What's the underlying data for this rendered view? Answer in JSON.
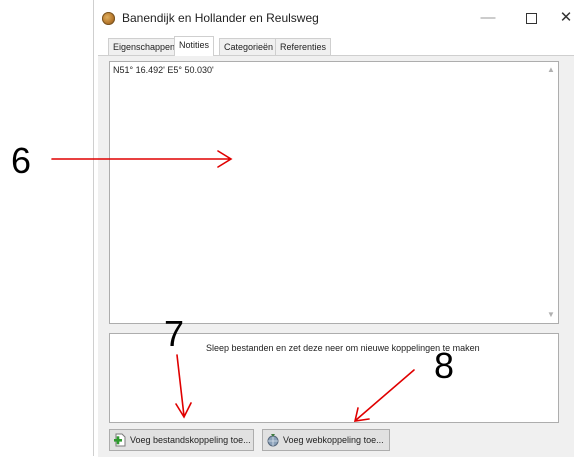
{
  "window": {
    "title": "Banendijk en Hollander en Reulsweg",
    "minimize_glyph": "—",
    "close_glyph": "✕"
  },
  "tabs": [
    {
      "label": "Eigenschappen",
      "active": false
    },
    {
      "label": "Notities",
      "active": true
    },
    {
      "label": "Categorieën",
      "active": false
    },
    {
      "label": "Referenties",
      "active": false
    }
  ],
  "notes": {
    "text": "N51° 16.492' E5° 50.030'"
  },
  "dropzone": {
    "text": "Sleep bestanden en zet deze neer om nieuwe koppelingen te maken"
  },
  "buttons": {
    "add_file_link": "Voeg bestandskoppeling toe...",
    "add_web_link": "Voeg webkoppeling toe..."
  },
  "annotations": {
    "six": "6",
    "seven": "7",
    "eight": "8",
    "arrow_color": "#e00000"
  },
  "icons": {
    "title": "geocache-coin-icon",
    "file_link": "file-add-icon",
    "web_link": "globe-link-icon"
  }
}
